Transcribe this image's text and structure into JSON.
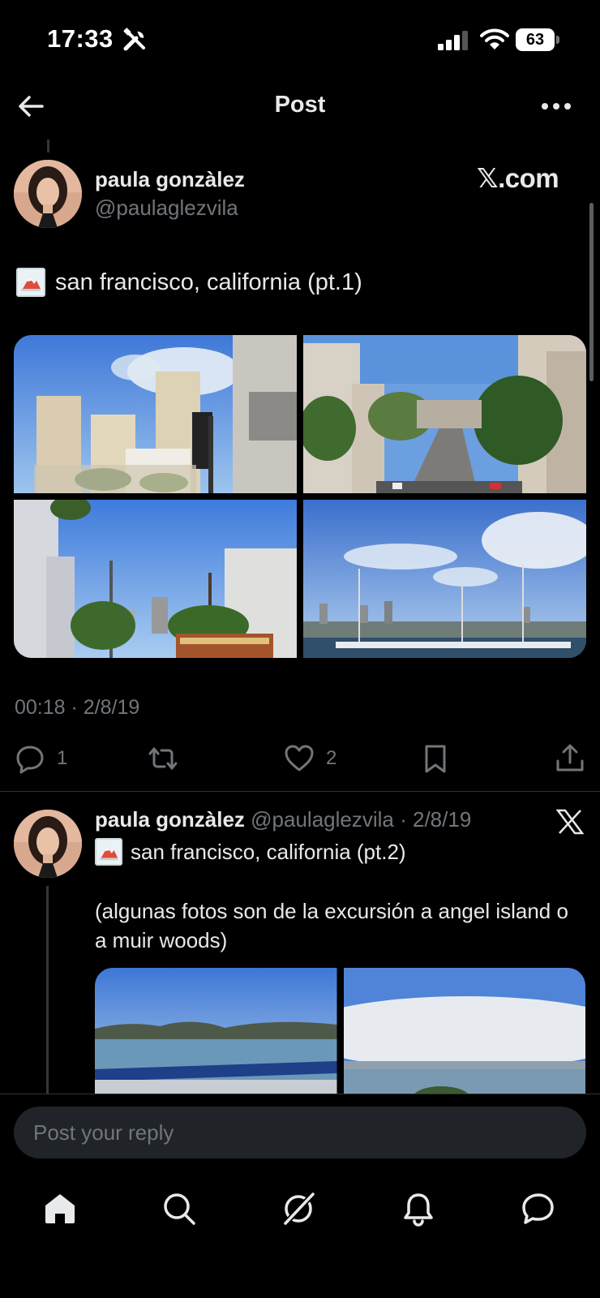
{
  "status_bar": {
    "time": "17:33",
    "battery": "63"
  },
  "header": {
    "title": "Post"
  },
  "post": {
    "author_name": "paula gonzàlez",
    "author_handle": "@paulaglezvila",
    "source_badge": "𝕏.com",
    "text": "san francisco, california (pt.1)",
    "timestamp": "00:18 · 2/8/19",
    "reply_count": "1",
    "like_count": "2",
    "images": [
      "san-francisco-skyscrapers",
      "san-francisco-street-hill",
      "san-francisco-cable-car-street",
      "san-francisco-marina"
    ]
  },
  "reply": {
    "author_name": "paula gonzàlez",
    "author_handle": "@paulaglezvila",
    "date": "· 2/8/19",
    "line1": "san francisco, california (pt.2)",
    "body": "(algunas fotos son de la excursión a angel island o a muir woods)",
    "images": [
      "bay-water-view",
      "cloudy-bay-skyline"
    ]
  },
  "composer": {
    "placeholder": "Post your reply"
  },
  "nav": {
    "items": [
      "home-icon",
      "search-icon",
      "grok-icon",
      "notifications-icon",
      "messages-icon"
    ]
  },
  "colors": {
    "background": "#000000",
    "text_primary": "#e7e9ea",
    "text_secondary": "#71767b",
    "divider": "#2f3336"
  }
}
